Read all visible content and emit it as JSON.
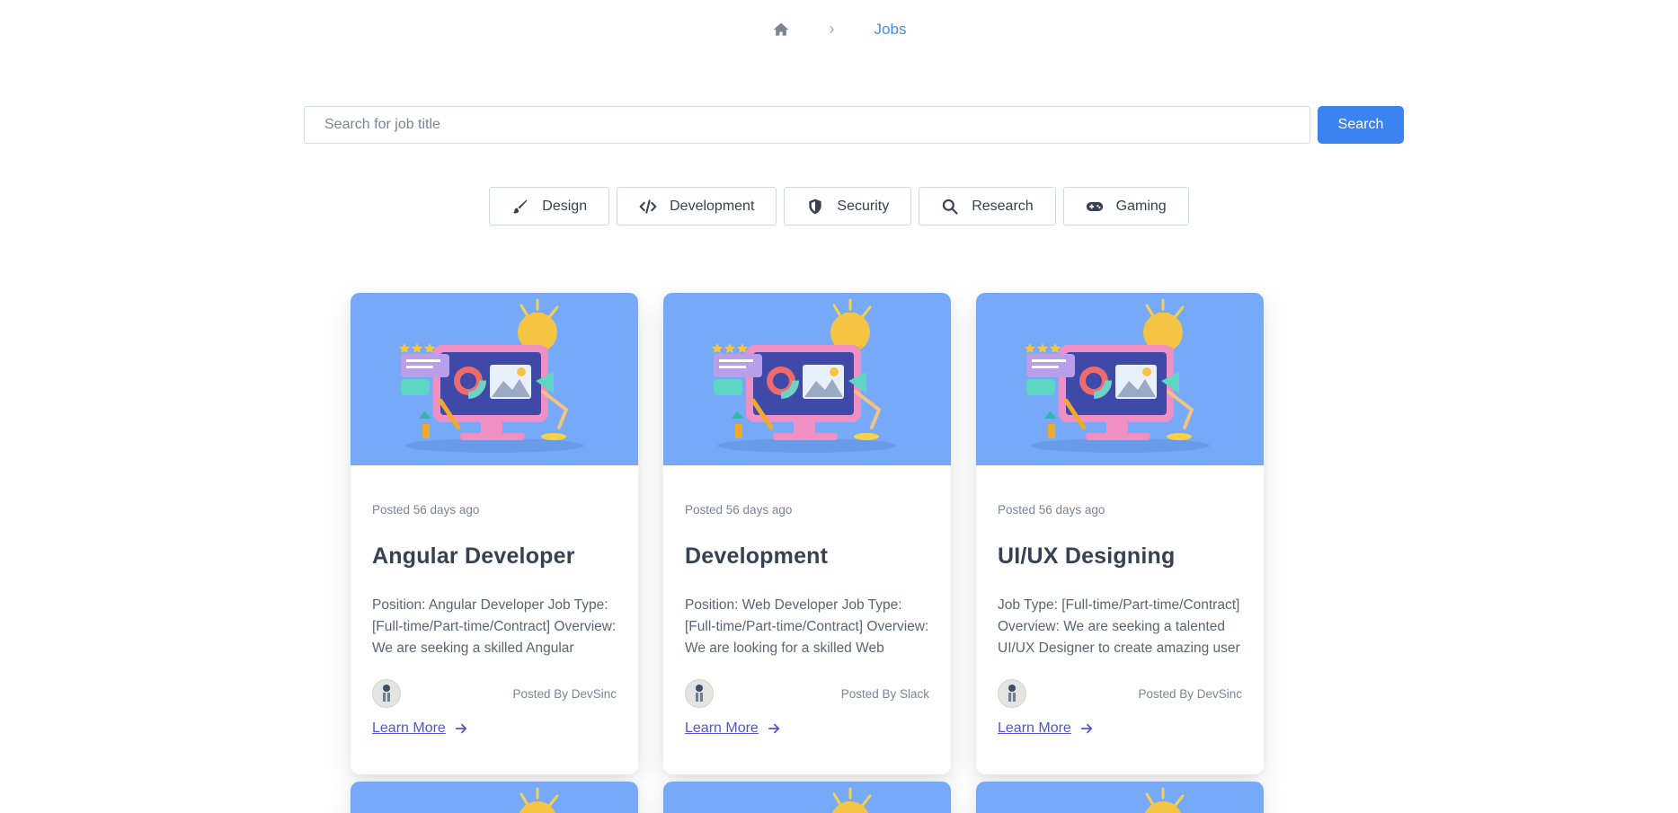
{
  "breadcrumb": {
    "home_icon": "home-icon",
    "separator": "›",
    "current": "Jobs"
  },
  "search": {
    "value": "",
    "placeholder": "Search for job title",
    "button_label": "Search"
  },
  "categories": [
    {
      "label": "Design",
      "icon": "brush-icon"
    },
    {
      "label": "Development",
      "icon": "code-icon"
    },
    {
      "label": "Security",
      "icon": "shield-icon"
    },
    {
      "label": "Research",
      "icon": "search-icon"
    },
    {
      "label": "Gaming",
      "icon": "gamepad-icon"
    }
  ],
  "cards": [
    {
      "posted": "Posted 56 days ago",
      "title": "Angular Developer",
      "description": "Position: Angular Developer Job Type: [Full-time/Part-time/Contract] Overview: We are seeking a skilled Angular Developer to join our team.",
      "posted_by": "Posted By DevSinc",
      "link": "Learn More"
    },
    {
      "posted": "Posted 56 days ago",
      "title": "Development",
      "description": "Position: Web Developer Job Type: [Full-time/Part-time/Contract] Overview: We are looking for a skilled Web Developer to join our team. The",
      "posted_by": "Posted By Slack",
      "link": "Learn More"
    },
    {
      "posted": "Posted 56 days ago",
      "title": "UI/UX Designing",
      "description": "Job Type: [Full-time/Part-time/Contract] Overview: We are seeking a talented UI/UX Designer to create amazing user experiences. The",
      "posted_by": "Posted By DevSinc",
      "link": "Learn More"
    }
  ],
  "colors": {
    "accent": "#3a83f1",
    "card_image_bg": "#76a9f8",
    "link": "#5256c9",
    "breadcrumb_active": "#4a8be6"
  }
}
